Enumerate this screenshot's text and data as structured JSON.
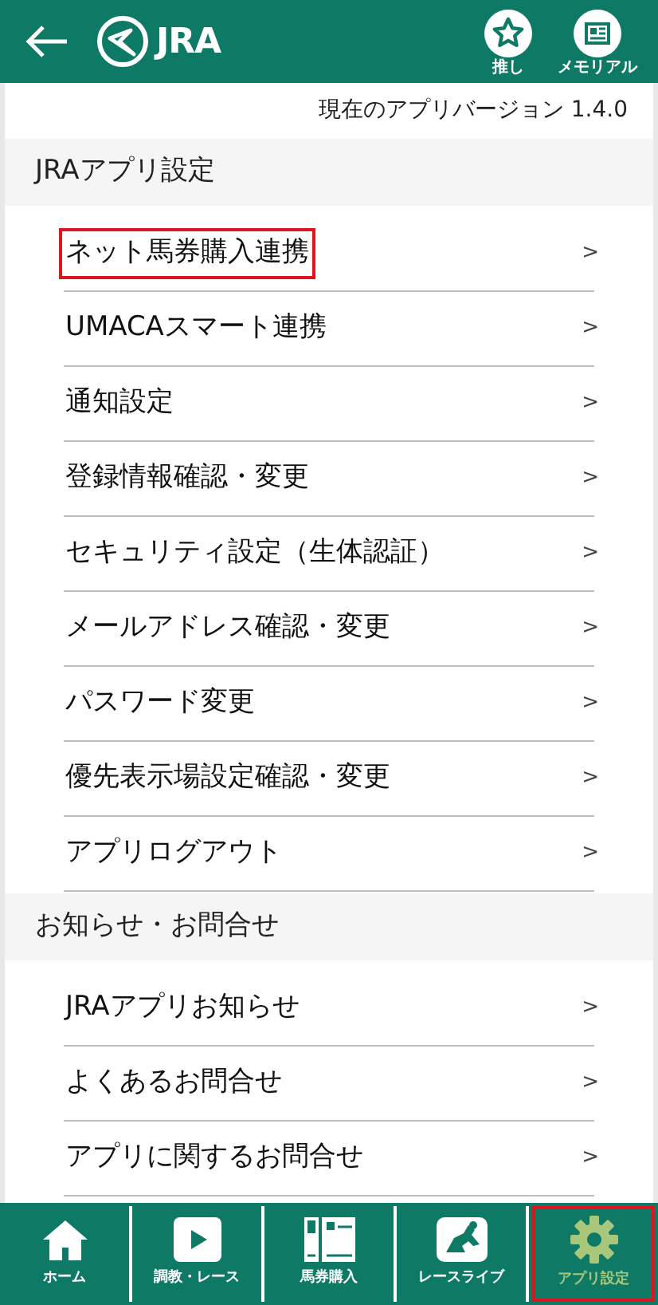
{
  "header": {
    "logo_text": "JRA",
    "actions": [
      {
        "kind": "star",
        "label": "推し"
      },
      {
        "kind": "memorial",
        "label": "メモリアル"
      }
    ]
  },
  "version": "現在のアプリバージョン 1.4.0",
  "sections": [
    {
      "title": "JRAアプリ設定",
      "items": [
        {
          "label": "ネット馬券購入連携",
          "chevron": ">",
          "highlighted": true
        },
        {
          "label": "UMACAスマート連携",
          "chevron": ">",
          "highlighted": false
        },
        {
          "label": "通知設定",
          "chevron": ">",
          "highlighted": false
        },
        {
          "label": "登録情報確認・変更",
          "chevron": ">",
          "highlighted": false
        },
        {
          "label": "セキュリティ設定（生体認証）",
          "chevron": ">",
          "highlighted": false
        },
        {
          "label": "メールアドレス確認・変更",
          "chevron": ">",
          "highlighted": false
        },
        {
          "label": "パスワード変更",
          "chevron": ">",
          "highlighted": false
        },
        {
          "label": "優先表示場設定確認・変更",
          "chevron": ">",
          "highlighted": false
        },
        {
          "label": "アプリログアウト",
          "chevron": ">",
          "highlighted": false
        }
      ]
    },
    {
      "title": "お知らせ・お問合せ",
      "items": [
        {
          "label": "JRAアプリお知らせ",
          "chevron": ">",
          "highlighted": false
        },
        {
          "label": "よくあるお問合せ",
          "chevron": ">",
          "highlighted": false
        },
        {
          "label": "アプリに関するお問合せ",
          "chevron": ">",
          "highlighted": false
        }
      ]
    }
  ],
  "tabs": [
    {
      "kind": "home",
      "label": "ホーム",
      "selected": false
    },
    {
      "kind": "play",
      "label": "調教・レース",
      "selected": false
    },
    {
      "kind": "ticket",
      "label": "馬券購入",
      "selected": false
    },
    {
      "kind": "horse",
      "label": "レースライブ",
      "selected": false
    },
    {
      "kind": "gear",
      "label": "アプリ設定",
      "selected": true
    }
  ]
}
